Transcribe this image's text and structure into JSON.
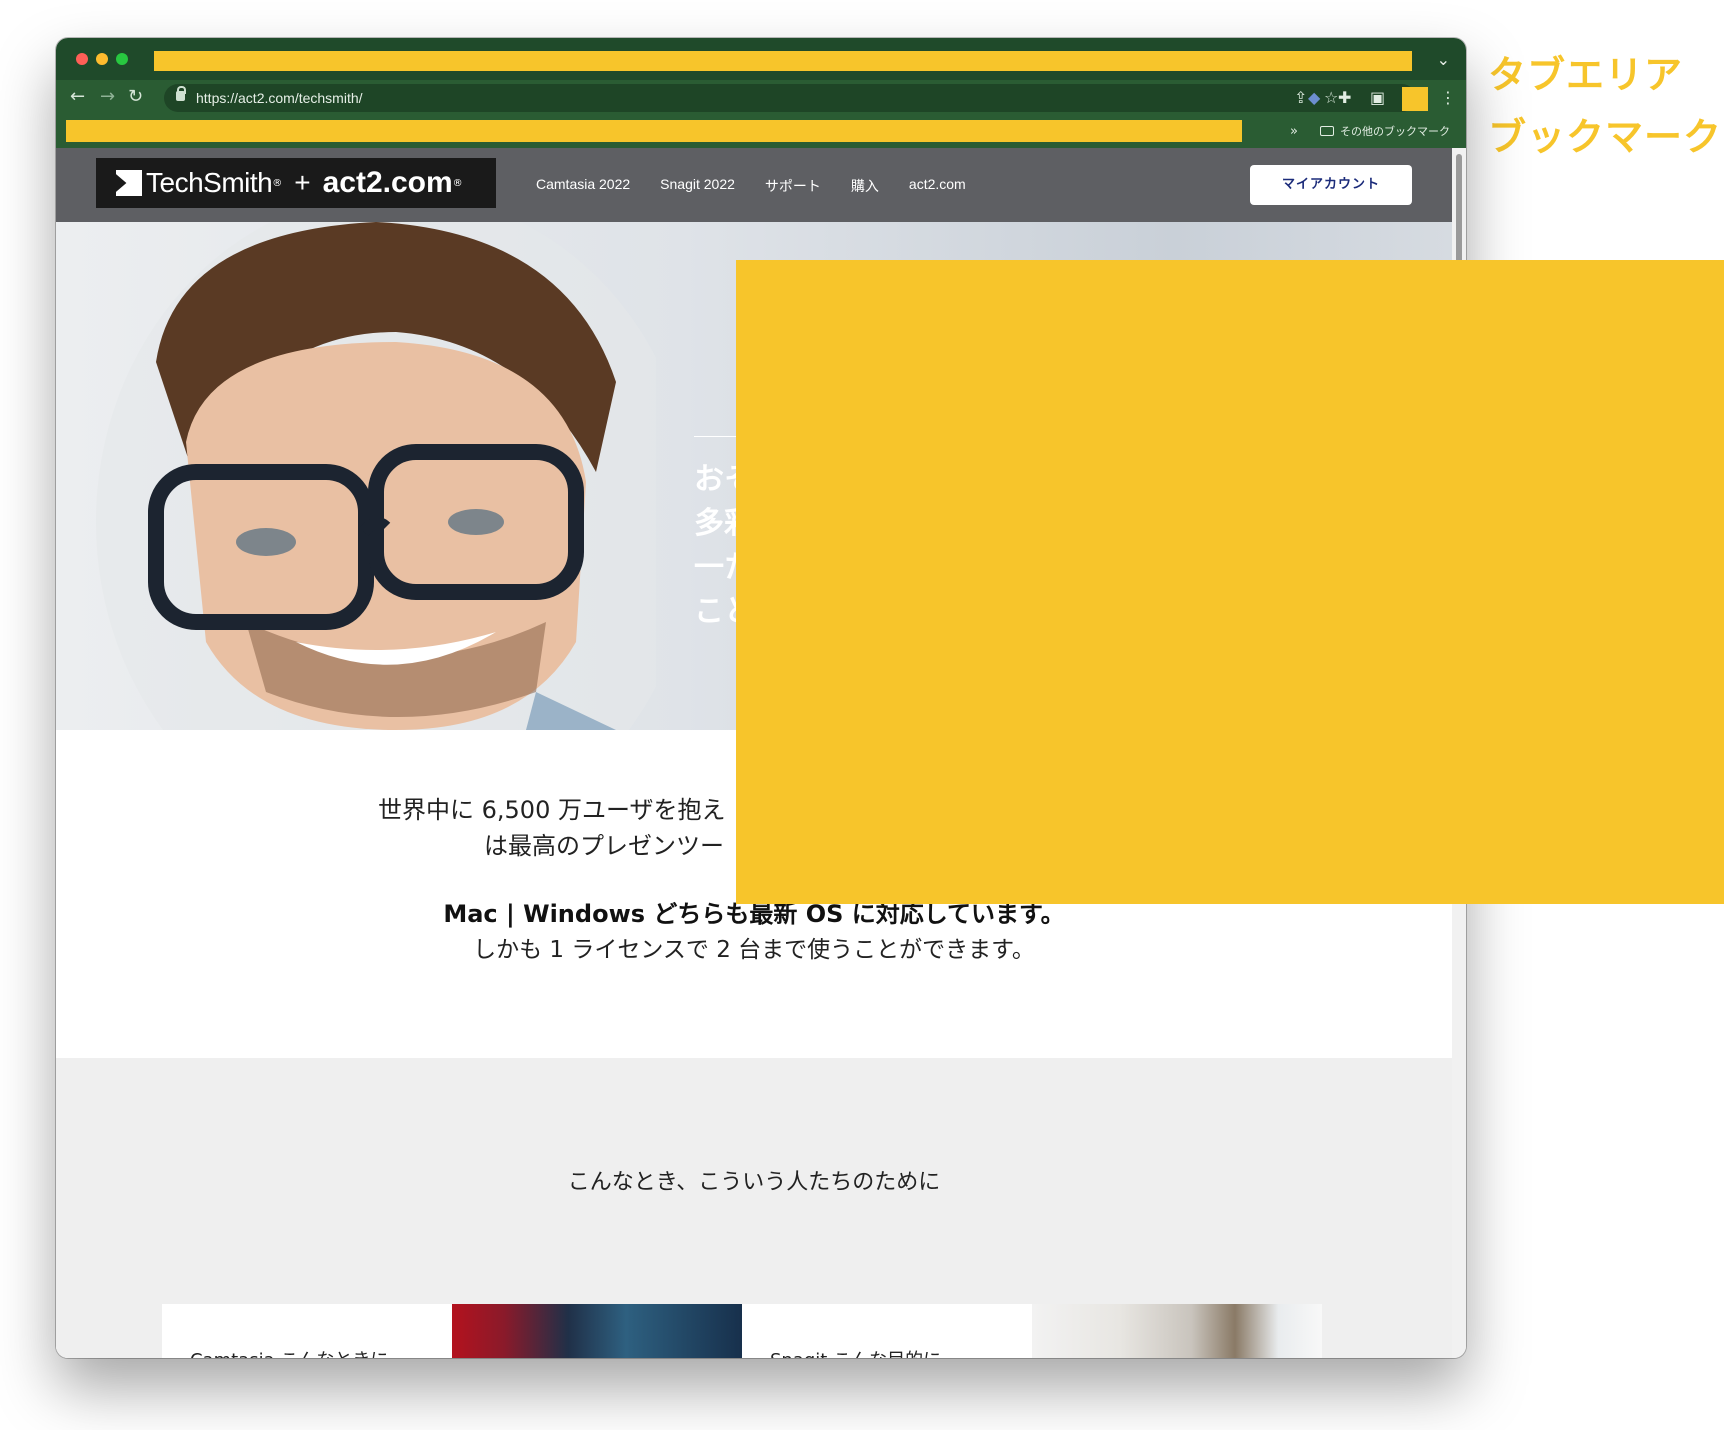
{
  "annotations": {
    "tab_area": "タブエリア",
    "bookmarks": "ブックマーク"
  },
  "browser": {
    "url": "https://act2.com/techsmith/",
    "bookmarks_more": "»",
    "other_bookmarks": "その他のブックマーク",
    "colors": {
      "chrome": "#2a5c33",
      "tabbar": "#1f4a2a",
      "mask": "#f7c52b"
    }
  },
  "site": {
    "logo": {
      "brand": "TechSmith",
      "reg": "®",
      "plus": "+",
      "partner": "act2.com",
      "partner_reg": "®"
    },
    "nav": [
      "Camtasia 2022",
      "Snagit 2022",
      "サポート",
      "購入",
      "act2.com"
    ],
    "account_button": "マイアカウント"
  },
  "hero": {
    "lines": [
      "おそ",
      "多彩",
      "一た",
      "こと"
    ]
  },
  "lead": {
    "line1": "世界中に 6,500 万ユーザを抱え",
    "line2": "は最高のプレゼンツー",
    "os_line": "Mac | Windows どちらも最新 OS に対応しています。",
    "license_line": "しかも 1 ライセンスで 2 台まで使うことができます。"
  },
  "section": {
    "title": "こんなとき、こういう人たちのために",
    "cards": [
      {
        "text": "Camtasia こんなときに"
      },
      {
        "text": "Snagit こんな目的に"
      }
    ]
  }
}
